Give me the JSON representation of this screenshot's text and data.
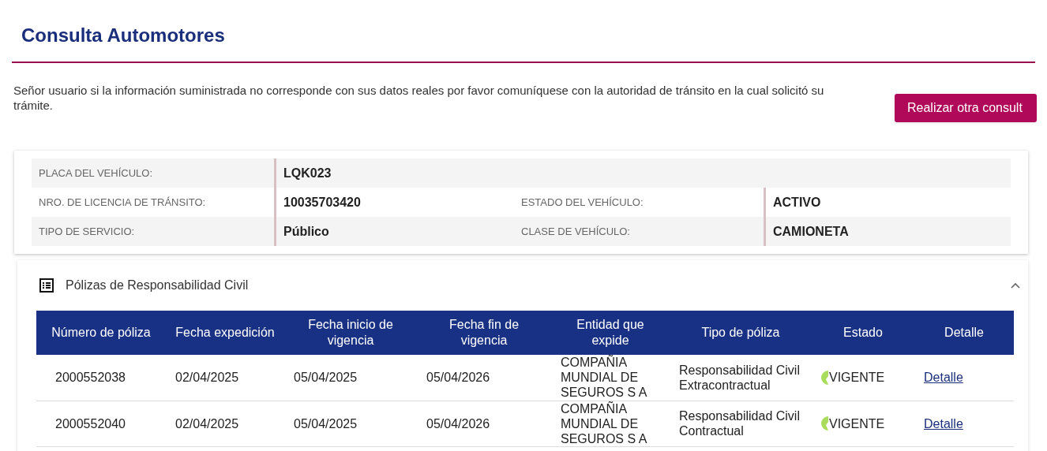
{
  "title": "Consulta Automotores",
  "notice": "Señor usuario si la información suministrada no corresponde con sus datos reales por favor comuníquese con la autoridad de tránsito en la cual solicitó su trámite.",
  "new_query_button": "Realizar otra consult",
  "vehicle": {
    "plate": {
      "label": "PLACA DEL VEHÍCULO:",
      "value": "LQK023"
    },
    "rows": [
      {
        "label": "NRO. DE LICENCIA DE TRÁNSITO:",
        "value": "10035703420",
        "label_2": "ESTADO DEL VEHÍCULO:",
        "value_2": "ACTIVO"
      },
      {
        "label": "TIPO DE SERVICIO:",
        "value": "Público",
        "label_2": "CLASE DE VEHÍCULO:",
        "value_2": "CAMIONETA"
      }
    ]
  },
  "policies": {
    "title": "Pólizas de Responsabilidad Civil",
    "expanded": true,
    "columns": [
      "Número de póliza",
      "Fecha expedición",
      "Fecha inicio de vigencia",
      "Fecha fin de vigencia",
      "Entidad que expide",
      "Tipo de póliza",
      "Estado",
      "Detalle"
    ],
    "rows": [
      {
        "number": "2000552038",
        "issued": "02/04/2025",
        "start": "05/04/2025",
        "end": "05/04/2026",
        "entity": "COMPAÑIA MUNDIAL DE SEGUROS S A",
        "type": "Responsabilidad Civil Extracontractual",
        "status": "VIGENTE",
        "detail": "Detalle"
      },
      {
        "number": "2000552040",
        "issued": "02/04/2025",
        "start": "05/04/2025",
        "end": "05/04/2026",
        "entity": "COMPAÑIA MUNDIAL DE SEGUROS S A",
        "type": "Responsabilidad Civil Contractual",
        "status": "VIGENTE",
        "detail": "Detalle"
      }
    ]
  }
}
